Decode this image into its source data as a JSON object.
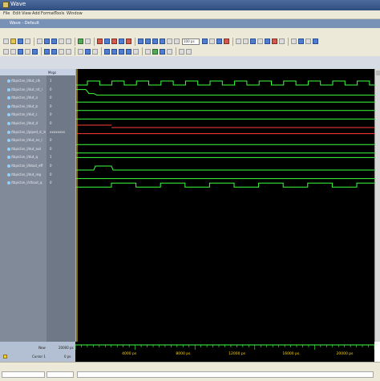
{
  "window": {
    "title": "Wave",
    "subtitle": "Wave - Default",
    "menus": [
      "File",
      "Edit",
      "View",
      "Add",
      "Format",
      "Tools",
      "Window"
    ]
  },
  "toolbar": {
    "zoom_value": "100 ps"
  },
  "pane_headers": {
    "names": "",
    "values": "Msgs"
  },
  "signals": [
    {
      "name": "/tbpiclan_l/dut_clk",
      "value": "1",
      "color": "#3cff3c",
      "kind": "clock"
    },
    {
      "name": "/tbpiclan_l/dut_rst_l",
      "value": "0",
      "color": "#3cff3c",
      "kind": "pulse"
    },
    {
      "name": "/tbpiclan_l/dut_a",
      "value": "0",
      "color": "#3cff3c",
      "kind": "low"
    },
    {
      "name": "/tbpiclan_l/dut_b",
      "value": "0",
      "color": "#3cff3c",
      "kind": "low"
    },
    {
      "name": "/tbpiclan_l/dut_c",
      "value": "0",
      "color": "#3cff3c",
      "kind": "low"
    },
    {
      "name": "/tbpiclan_l/dut_d",
      "value": "0",
      "color": "#ff3c3c",
      "kind": "red"
    },
    {
      "name": "/tbpiclan_l/piped_d_in",
      "value": "xxxxxxxx",
      "color": "#ff3c3c",
      "kind": "bus"
    },
    {
      "name": "/tbpiclan_l/dut_en_l",
      "value": "0",
      "color": "#3cff3c",
      "kind": "low"
    },
    {
      "name": "/tbpiclan_l/dut_out",
      "value": "0",
      "color": "#3cff3c",
      "kind": "low"
    },
    {
      "name": "/tbpiclan_l/dut_q",
      "value": "1",
      "color": "#3cff3c",
      "kind": "high"
    },
    {
      "name": "/tbpiclan_l/ldout_eff",
      "value": "0",
      "color": "#3cff3c",
      "kind": "late"
    },
    {
      "name": "/tbpiclan_l/dut_reg",
      "value": "0",
      "color": "#3cff3c",
      "kind": "low"
    },
    {
      "name": "/tbpiclan_l/clkout_q",
      "value": "0",
      "color": "#3cff3c",
      "kind": "slowclk"
    }
  ],
  "footer": {
    "now_label": "Now",
    "now_value": "20000 ps",
    "cursor_label": "Cursor 1",
    "cursor_value": "0 ps"
  },
  "ruler": {
    "ticks": [
      "4000 ps",
      "8000 ps",
      "12000 ps",
      "16000 ps",
      "20000 ps"
    ]
  },
  "colors": {
    "wave_green": "#3cff3c",
    "wave_red": "#ff3c3c",
    "cursor_yellow": "#ffd700"
  }
}
